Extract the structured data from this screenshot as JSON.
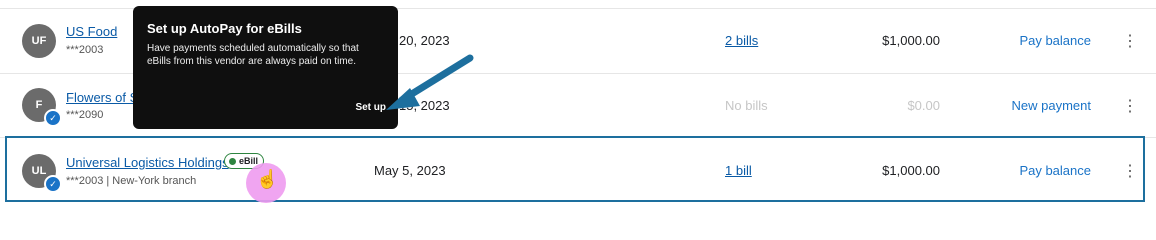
{
  "rows": [
    {
      "initials": "UF",
      "vendor": "US Food",
      "account": "***2003",
      "date": "20, 2023",
      "bills": "2 bills",
      "amount": "$1,000.00",
      "action": "Pay balance"
    },
    {
      "initials": "F",
      "vendor": "Flowers of S",
      "account": "***2090",
      "date": "15, 2023",
      "bills": "No bills",
      "amount": "$0.00",
      "action": "New payment"
    },
    {
      "initials": "UL",
      "vendor": "Universal Logistics Holdings",
      "account": "***2003 | New-York branch",
      "date": "May 5, 2023",
      "bills": "1 bill",
      "amount": "$1,000.00",
      "action": "Pay balance",
      "badge": "eBill"
    }
  ],
  "tooltip": {
    "title": "Set up AutoPay for eBills",
    "body": "Have payments scheduled automatically so that eBills from this vendor are always paid on time.",
    "button": "Set up"
  },
  "colors": {
    "link": "#0a5aa6",
    "action": "#1a73c7",
    "highlight_border": "#1d6f9e",
    "ebill_green": "#2e8540",
    "arrow": "#1d6f9e"
  },
  "icons": {
    "more": "more-vertical-icon",
    "verified": "verified-check-icon",
    "cursor": "hand-pointer-icon"
  }
}
